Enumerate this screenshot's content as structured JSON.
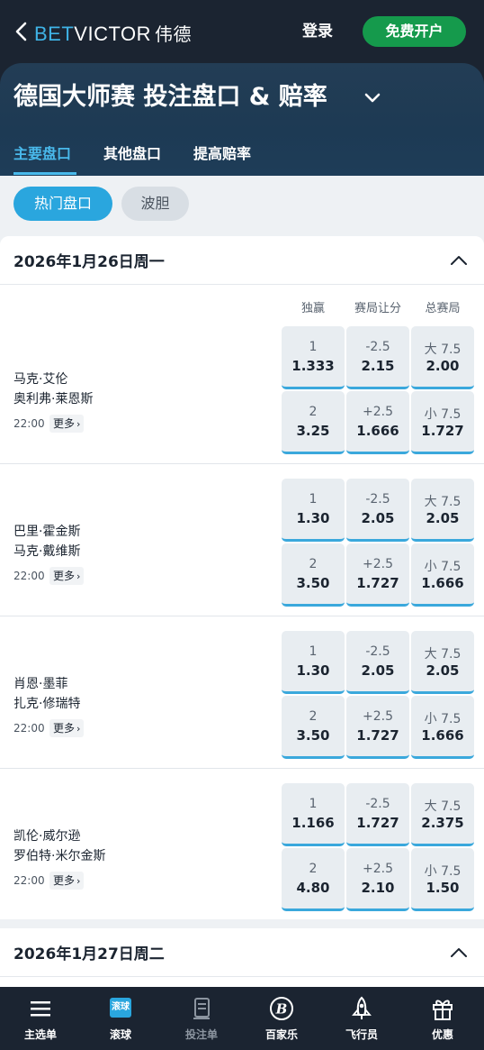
{
  "header": {
    "logo_bet": "BET",
    "logo_victor": "VICTOR",
    "logo_cn": "伟德",
    "login_label": "登录",
    "signup_label": "免费开户"
  },
  "page": {
    "title": "德国大师赛 投注盘口 & 赔率"
  },
  "tabs": [
    {
      "label": "主要盘口",
      "active": true
    },
    {
      "label": "其他盘口",
      "active": false
    },
    {
      "label": "提高赔率",
      "active": false
    }
  ],
  "chips": [
    {
      "label": "热门盘口",
      "active": true
    },
    {
      "label": "波胆",
      "active": false
    }
  ],
  "columns": [
    "独赢",
    "赛局让分",
    "总赛局"
  ],
  "dates": [
    {
      "label": "2026年1月26日周一"
    },
    {
      "label": "2026年1月27日周二"
    }
  ],
  "events": [
    {
      "player1": "马克·艾伦",
      "player2": "奥利弗·莱恩斯",
      "time": "22:00",
      "more": "更多",
      "row1": [
        {
          "label": "1",
          "price": "1.333"
        },
        {
          "label": "-2.5",
          "price": "2.15"
        },
        {
          "label": "大 7.5",
          "price": "2.00"
        }
      ],
      "row2": [
        {
          "label": "2",
          "price": "3.25"
        },
        {
          "label": "+2.5",
          "price": "1.666"
        },
        {
          "label": "小 7.5",
          "price": "1.727"
        }
      ]
    },
    {
      "player1": "巴里·霍金斯",
      "player2": "马克·戴维斯",
      "time": "22:00",
      "more": "更多",
      "row1": [
        {
          "label": "1",
          "price": "1.30"
        },
        {
          "label": "-2.5",
          "price": "2.05"
        },
        {
          "label": "大 7.5",
          "price": "2.05"
        }
      ],
      "row2": [
        {
          "label": "2",
          "price": "3.50"
        },
        {
          "label": "+2.5",
          "price": "1.727"
        },
        {
          "label": "小 7.5",
          "price": "1.666"
        }
      ]
    },
    {
      "player1": "肖恩·墨菲",
      "player2": "扎克·修瑞特",
      "time": "22:00",
      "more": "更多",
      "row1": [
        {
          "label": "1",
          "price": "1.30"
        },
        {
          "label": "-2.5",
          "price": "2.05"
        },
        {
          "label": "大 7.5",
          "price": "2.05"
        }
      ],
      "row2": [
        {
          "label": "2",
          "price": "3.50"
        },
        {
          "label": "+2.5",
          "price": "1.727"
        },
        {
          "label": "小 7.5",
          "price": "1.666"
        }
      ]
    },
    {
      "player1": "凯伦·威尔逊",
      "player2": "罗伯特·米尔金斯",
      "time": "22:00",
      "more": "更多",
      "row1": [
        {
          "label": "1",
          "price": "1.166"
        },
        {
          "label": "-2.5",
          "price": "1.727"
        },
        {
          "label": "大 7.5",
          "price": "2.375"
        }
      ],
      "row2": [
        {
          "label": "2",
          "price": "4.80"
        },
        {
          "label": "+2.5",
          "price": "2.10"
        },
        {
          "label": "小 7.5",
          "price": "1.50"
        }
      ]
    }
  ],
  "bottom_nav": [
    {
      "label": "主选单",
      "icon": "menu-icon"
    },
    {
      "label": "滚球",
      "icon": "live-icon",
      "badge": "滚球"
    },
    {
      "label": "投注单",
      "icon": "betslip-icon"
    },
    {
      "label": "百家乐",
      "icon": "baccarat-icon"
    },
    {
      "label": "飞行员",
      "icon": "rocket-icon"
    },
    {
      "label": "优惠",
      "icon": "gift-icon"
    }
  ],
  "colors": {
    "header_bg": "#1b2431",
    "accent_blue": "#2aa6de",
    "signup_green": "#159a4c"
  }
}
